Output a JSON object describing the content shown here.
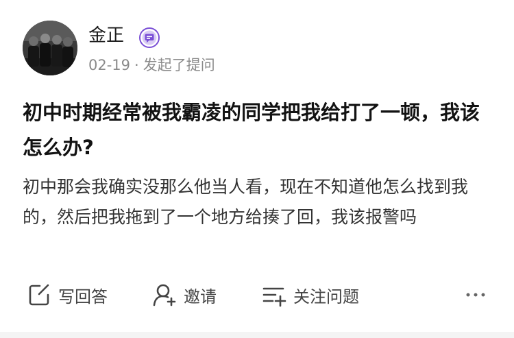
{
  "author": {
    "name": "金正",
    "avatar_icon": "avatar-photo",
    "badge_icon": "message-badge-icon"
  },
  "meta": {
    "date": "02-19",
    "separator": "·",
    "action": "发起了提问"
  },
  "question": {
    "title": "初中时期经常被我霸凌的同学把我给打了一顿，我该怎么办?",
    "body": "初中那会我确实没那么他当人看，现在不知道他怎么找到我的，然后把我拖到了一个地方给揍了回，我该报警吗"
  },
  "actions": {
    "answer": {
      "label": "写回答",
      "icon": "edit-icon"
    },
    "invite": {
      "label": "邀请",
      "icon": "add-user-icon"
    },
    "follow": {
      "label": "关注问题",
      "icon": "add-list-icon"
    },
    "more_icon": "more-icon"
  },
  "colors": {
    "badge_outer": "#7a4fd6",
    "text_primary": "#121212",
    "text_secondary": "#8a8a8a",
    "icon_gray": "#444444"
  }
}
